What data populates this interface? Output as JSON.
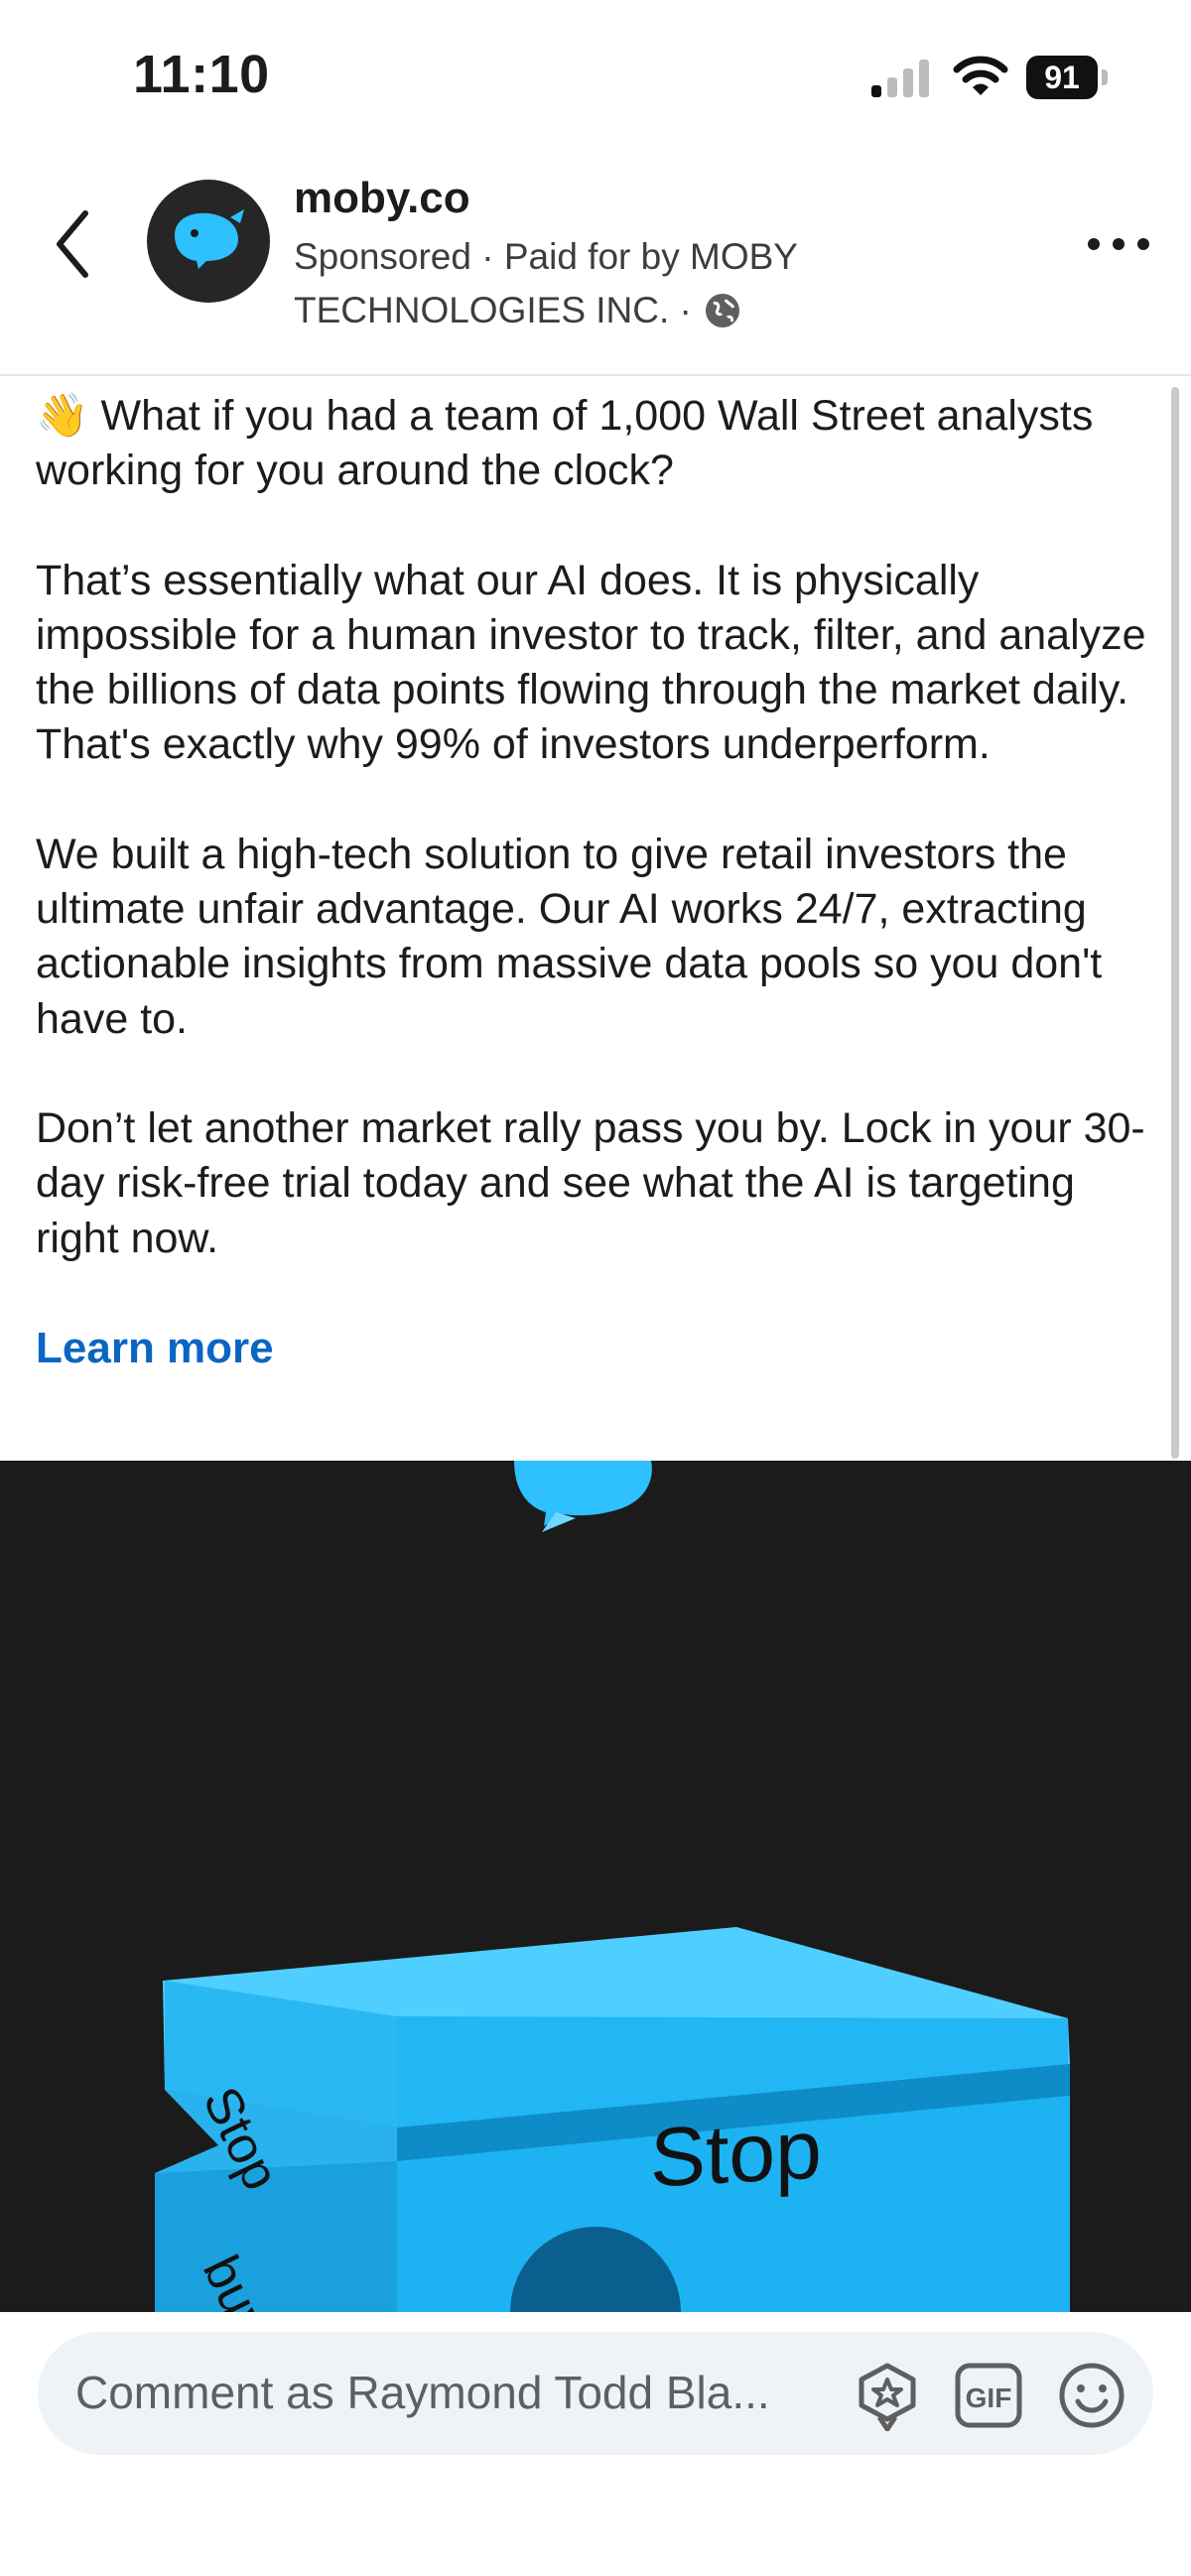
{
  "status_bar": {
    "time": "11:10",
    "battery": "91"
  },
  "header": {
    "advertiser": "moby.co",
    "meta_line1": "Sponsored · Paid for by MOBY",
    "meta_line2": "TECHNOLOGIES INC. ·"
  },
  "post": {
    "paragraphs": [
      "👋 What if you had a team of 1,000 Wall Street analysts working for you around the clock?",
      "That’s essentially what our AI does. It is physically impossible for a human investor to track, filter, and analyze the billions of data points flowing through the market daily. That's exactly why 99% of investors underperform.",
      "We built a high-tech solution to give retail investors the ultimate unfair advantage. Our AI works 24/7, extracting actionable insights from massive data pools so you don't have to.",
      "Don’t let another market rally pass you by. Lock in your 30-day risk-free trial today and see what the AI is targeting right now."
    ],
    "cta": "Learn more"
  },
  "media": {
    "block_text_front": "Stop",
    "block_text_side_top": "Stop",
    "block_text_side_bottom": "buying",
    "accent": "#2ec0ff"
  },
  "comment": {
    "placeholder": "Comment as Raymond Todd Bla..."
  },
  "icons": [
    "back-icon",
    "more-icon",
    "globe-icon",
    "whale-icon",
    "sticker-icon",
    "gif-icon",
    "emoji-icon"
  ]
}
